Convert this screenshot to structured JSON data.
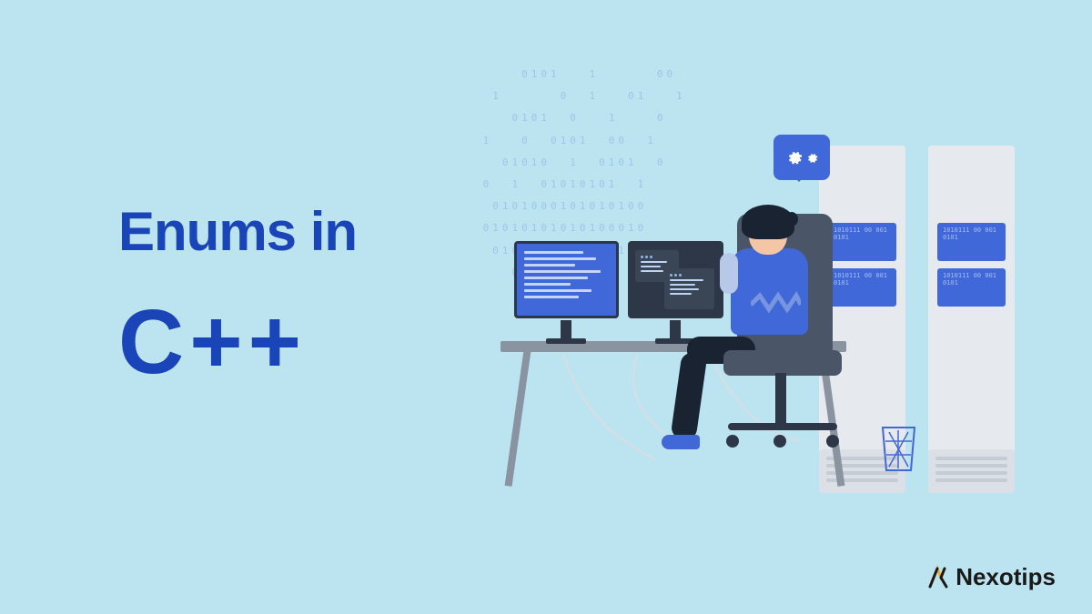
{
  "title": {
    "line1": "Enums in",
    "line2": "C++"
  },
  "logo": {
    "text": "Nexotips"
  },
  "illustration": {
    "binary_pattern": "     0101   1      00\n  1      0  1   01   1\n    0101  0   1    0\n 1   0  0101  00  1\n   01010  1  0101  0\n 0  1  01010101  1\n  0101000101010100\n 01010101010100010\n  010101010101010\n    0101010101\n      01010",
    "server_led": "1010111 00\n001 0101"
  }
}
